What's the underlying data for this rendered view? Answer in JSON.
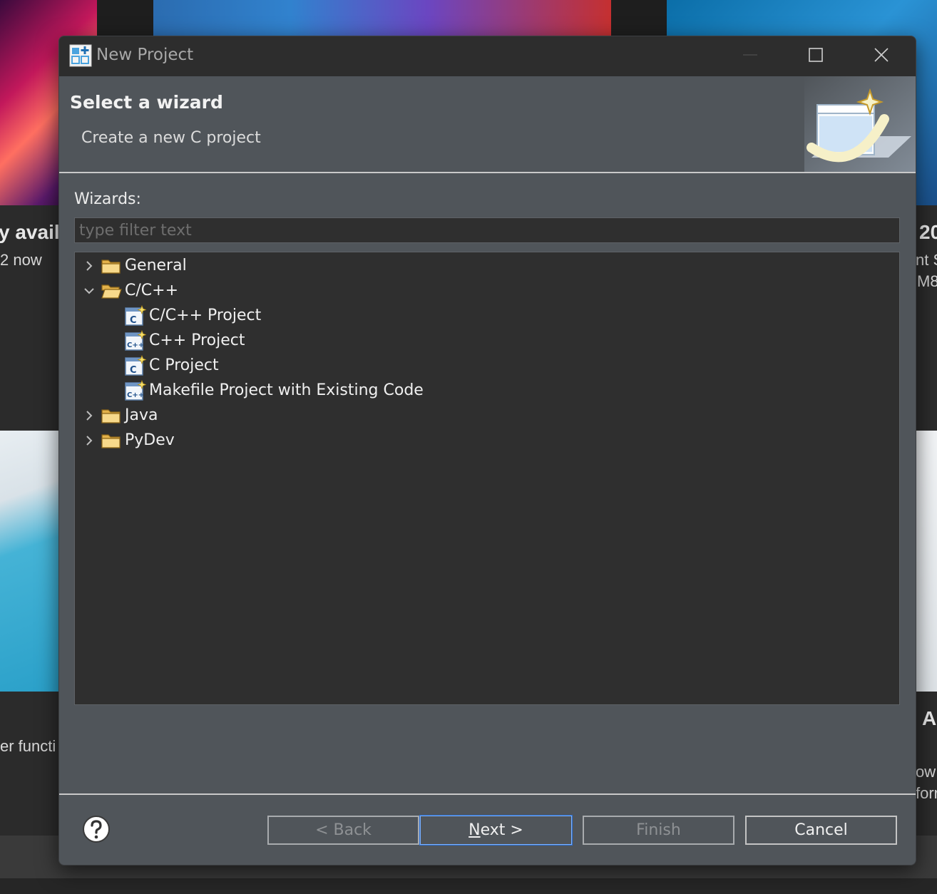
{
  "background": {
    "left_title": "y availa",
    "left_sub": "2 now",
    "left_sub2": "er functi",
    "right_title": "20",
    "right_sub1": "nt S",
    "right_sub2": "M8",
    "right_title2": "A",
    "right_sub3": "ow",
    "right_sub4": "forr"
  },
  "dialog": {
    "title": "New Project",
    "header": {
      "title": "Select a wizard",
      "description": "Create a new C project"
    },
    "wizards_label": "Wizards:",
    "filter": {
      "value": "",
      "placeholder": "type filter text"
    },
    "tree": [
      {
        "label": "General",
        "type": "folder",
        "expanded": false,
        "icon": "folder-icon"
      },
      {
        "label": "C/C++",
        "type": "folder",
        "expanded": true,
        "icon": "folder-open-icon"
      },
      {
        "label": "C/C++ Project",
        "type": "wizard",
        "icon": "c-project-wizard-icon"
      },
      {
        "label": "C++ Project",
        "type": "wizard",
        "icon": "cpp-project-wizard-icon"
      },
      {
        "label": "C Project",
        "type": "wizard",
        "icon": "c-project-wizard-icon"
      },
      {
        "label": "Makefile Project with Existing Code",
        "type": "wizard",
        "icon": "cpp-project-wizard-icon"
      },
      {
        "label": "Java",
        "type": "folder",
        "expanded": false,
        "icon": "folder-icon"
      },
      {
        "label": "PyDev",
        "type": "folder",
        "expanded": false,
        "icon": "folder-icon"
      }
    ],
    "buttons": {
      "back": "< Back",
      "next_mnemonic": "N",
      "next_rest": "ext >",
      "finish": "Finish",
      "cancel": "Cancel"
    },
    "colors": {
      "dialog_bg": "#50555a",
      "titlebar_bg": "#2d2d2d",
      "tree_bg": "#2f2f2f",
      "primary_focus": "#2e6fd0"
    }
  }
}
